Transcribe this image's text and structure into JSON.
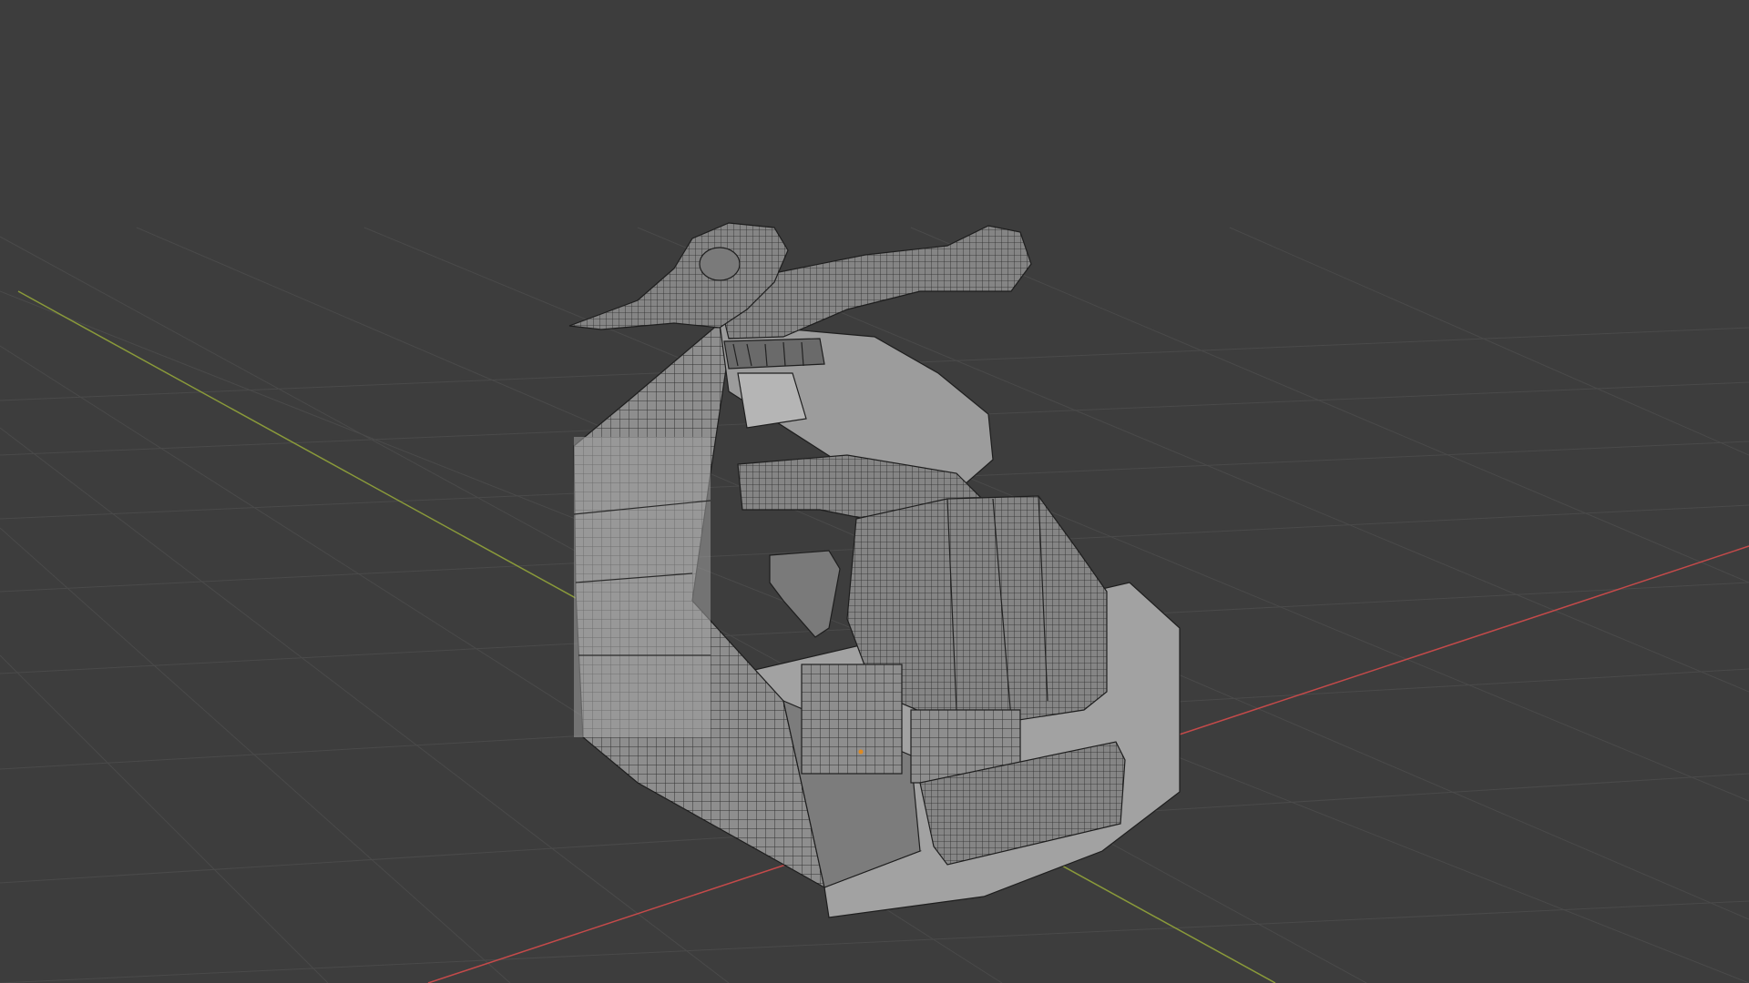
{
  "app": "3d-modeling-viewport",
  "viewport": {
    "shading": "solid-wireframe-overlay",
    "background_color": "#3d3d3d",
    "grid_color": "#4a4a4a",
    "x_axis_color": "#c44a4a",
    "y_axis_color": "#8a9a3a"
  },
  "model": {
    "name_icon": "robot-cockpit-model",
    "base_color": "#9a9a9a",
    "edge_color": "#1e1e1e",
    "selected_vertex_color": "#e08a20"
  }
}
